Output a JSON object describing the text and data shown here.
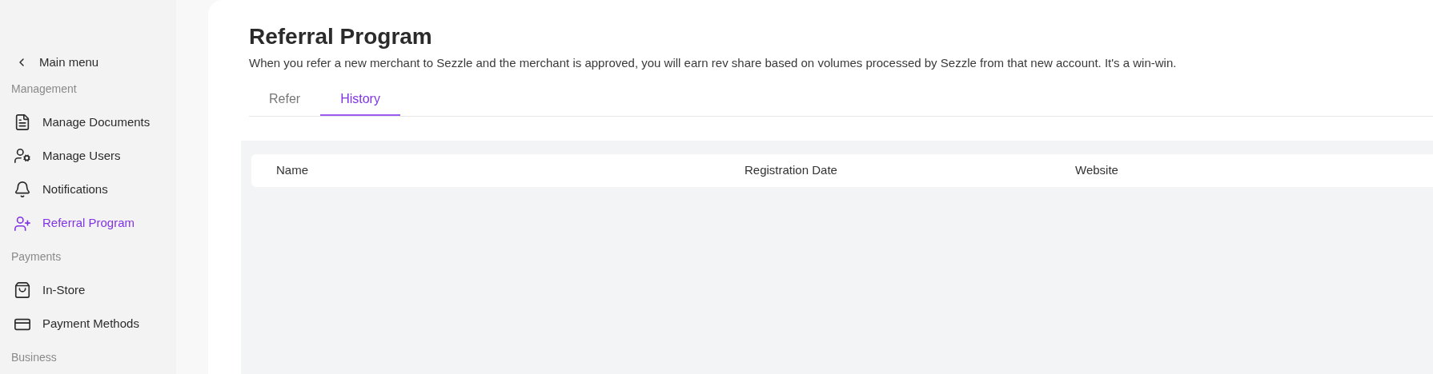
{
  "sidebar": {
    "back": {
      "label": "Main menu"
    },
    "entries": [
      {
        "kind": "heading",
        "label": "Management"
      },
      {
        "kind": "item",
        "label": "Manage Documents",
        "selected": false
      },
      {
        "kind": "item",
        "label": "Manage Users",
        "selected": false
      },
      {
        "kind": "item",
        "label": "Notifications",
        "selected": false
      },
      {
        "kind": "item",
        "label": "Referral Program",
        "selected": true
      },
      {
        "kind": "heading",
        "label": "Payments"
      },
      {
        "kind": "item",
        "label": "In-Store",
        "selected": false
      },
      {
        "kind": "item",
        "label": "Payment Methods",
        "selected": false
      },
      {
        "kind": "heading",
        "label": "Business"
      }
    ]
  },
  "page": {
    "title": "Referral Program",
    "description": "When you refer a new merchant to Sezzle and the merchant is approved, you will earn rev share based on volumes processed by Sezzle from that new account. It's a win-win.",
    "tabs": [
      {
        "label": "Refer",
        "selected": false
      },
      {
        "label": "History",
        "selected": true
      }
    ],
    "table": {
      "columns": [
        "Name",
        "Registration Date",
        "Website"
      ]
    }
  }
}
